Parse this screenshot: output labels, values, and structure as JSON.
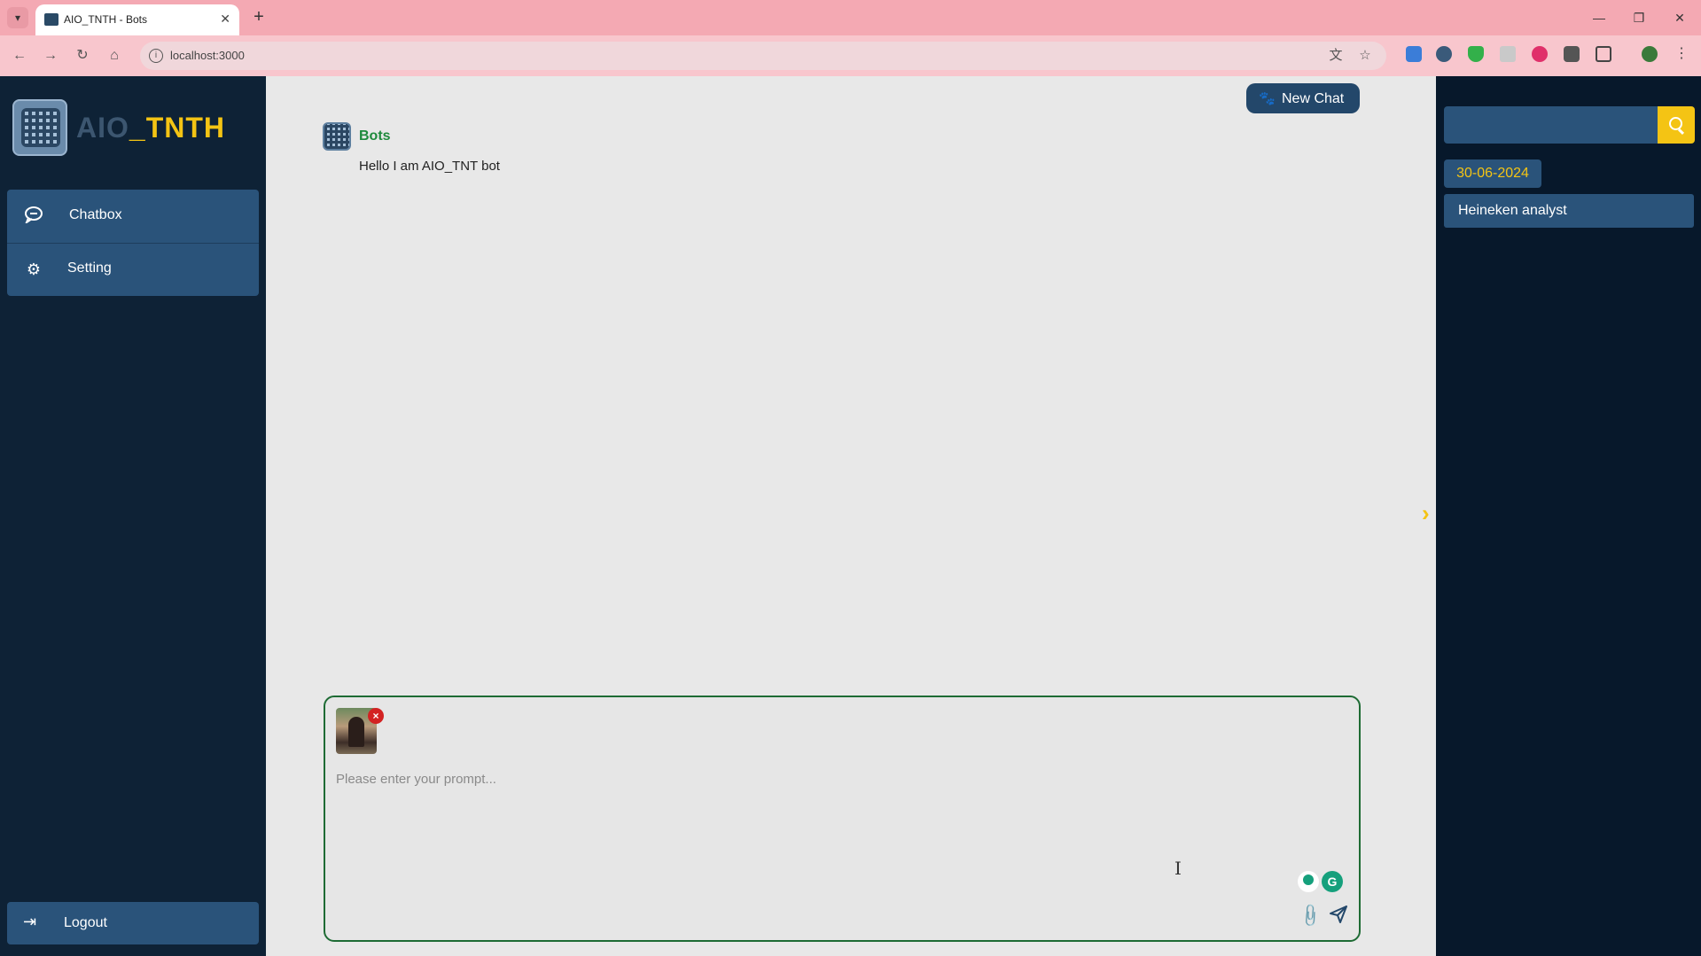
{
  "browser": {
    "tab_title": "AIO_TNTH - Bots",
    "url": "localhost:3000"
  },
  "sidebar": {
    "logo_prefix": "AIO",
    "logo_suffix": "_TNTH",
    "items": [
      {
        "label": "Chatbox",
        "icon": "chat-icon"
      },
      {
        "label": "Setting",
        "icon": "gear-icon"
      }
    ],
    "logout_label": "Logout"
  },
  "main": {
    "new_chat_label": "New Chat",
    "messages": [
      {
        "sender": "Bots",
        "text": "Hello I am AIO_TNT bot"
      }
    ],
    "prompt": {
      "placeholder": "Please enter your prompt...",
      "value": ""
    }
  },
  "history": {
    "search_placeholder": "",
    "groups": [
      {
        "date": "30-06-2024",
        "items": [
          "Heineken analyst"
        ]
      }
    ]
  },
  "colors": {
    "sidebar_bg": "#0e2236",
    "panel_bg": "#07182b",
    "button_bg": "#2a537a",
    "accent_yellow": "#f4c414",
    "bot_name_green": "#1e8a3c",
    "prompt_border": "#1e6b34"
  }
}
